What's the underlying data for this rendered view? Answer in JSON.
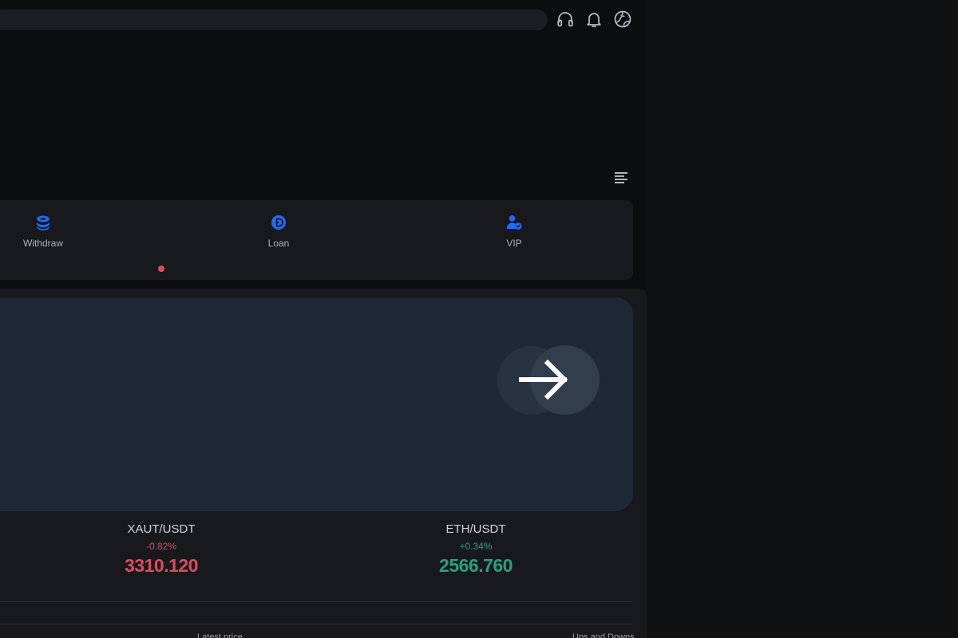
{
  "header": {
    "icons": [
      "headset-icon",
      "bell-icon",
      "globe-icon"
    ]
  },
  "toolbar": {
    "menu_icon": "menu-lines-icon"
  },
  "quick_actions": [
    {
      "label": "Withdraw",
      "icon": "withdraw-coins-icon"
    },
    {
      "label": "Loan",
      "icon": "loan-coin-icon"
    },
    {
      "label": "VIP",
      "icon": "vip-user-icon"
    }
  ],
  "carousel": {
    "active_dot_color": "#e84a5f"
  },
  "banner": {
    "arrow_icon": "arrow-right-icon"
  },
  "tickers": [
    {
      "pair": "XAUT/USDT",
      "change": "-0.82%",
      "price": "3310.120",
      "trend": "down"
    },
    {
      "pair": "ETH/USDT",
      "change": "+0.34%",
      "price": "2566.760",
      "trend": "up"
    }
  ],
  "market_table": {
    "headers": [
      "Latest price",
      "Ups and Downs"
    ]
  },
  "colors": {
    "accent": "#1e6bff",
    "down": "#e04a5d",
    "up": "#27a17f",
    "panel": "#17191d",
    "banner": "#1f2836"
  }
}
